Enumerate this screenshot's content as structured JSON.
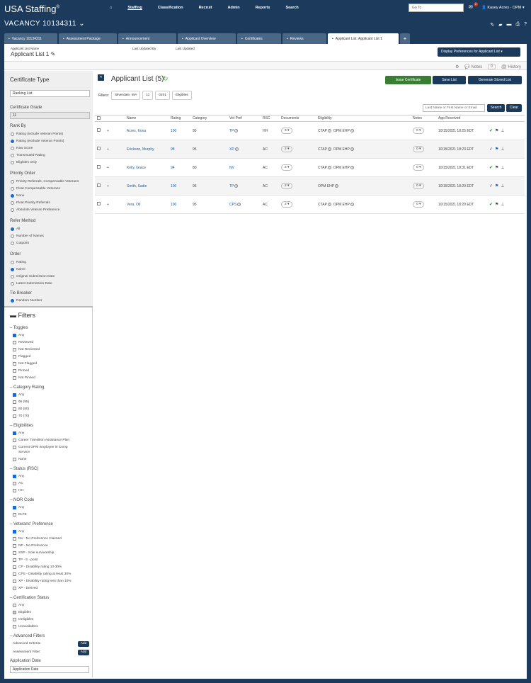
{
  "app": {
    "logo": "USA Staffing",
    "logo_mark": "®",
    "nav": [
      "Staffing",
      "Classification",
      "Recruit",
      "Admin",
      "Reports",
      "Search"
    ],
    "goto_placeholder": "Go To",
    "mail_count": "2",
    "user": "Kasey Acres - OPM"
  },
  "vacancy": {
    "title": "VACANCY 10134311"
  },
  "tabs": [
    "Vacancy 10134311",
    "Assessment Package",
    "Announcement",
    "Applicant Overview",
    "Certificates",
    "Reviews",
    "Applicant List: Applicant List 1"
  ],
  "header": {
    "list_name_label": "Applicant List Name",
    "list_name": "Applicant List 1",
    "updated_by_label": "Last Updated By",
    "updated_label": "Last Updated",
    "display_prefs": "Display Preferences for Applicant List"
  },
  "strip": {
    "notes": "Notes",
    "notes_count": "0",
    "history": "History"
  },
  "left": {
    "cert_type_title": "Certificate Type",
    "cert_type_value": "Ranking List",
    "cert_grade_label": "Certificate Grade",
    "cert_grade_value": "11",
    "rank_by_label": "Rank By",
    "rank_by": [
      "Rating (include Veteran Points)",
      "Rating (exclude Veteran Points)",
      "Raw Score",
      "Transmuted Rating",
      "Eligibles Only"
    ],
    "priority_label": "Priority Order",
    "priority": [
      "Priority Referrals, Compensable Veterans",
      "Float Compensable Veterans",
      "None",
      "Float Priority Referrals",
      "Absolute Veteran Preference"
    ],
    "refer_label": "Refer Method",
    "refer": [
      "All",
      "Number of Names",
      "Cutpoint"
    ],
    "order_label": "Order",
    "order": [
      "Rating",
      "Name",
      "Original Submission Date",
      "Latest Submission Date"
    ],
    "tie_label": "Tie Breaker",
    "tie": [
      "Random Number"
    ],
    "filters_title": "Filters",
    "toggles_label": "Toggles",
    "toggles": [
      "Any",
      "Reviewed",
      "Not Reviewed",
      "Flagged",
      "Not Flagged",
      "Pinned",
      "Not Pinned"
    ],
    "catrating_label": "Category Rating",
    "catrating": [
      "Any",
      "95 (95)",
      "80 (80)",
      "70 (70)"
    ],
    "elig_label": "Eligibilities",
    "elig": [
      "Any",
      "Career Transition Assistance Plan",
      "Current OPM employee in Comp",
      "Service",
      "None"
    ],
    "status_label": "Status (RSC)",
    "status": [
      "Any",
      "AC",
      "HH"
    ],
    "nor_label": "NOR Code",
    "nor": [
      "Any",
      "ELTE"
    ],
    "vet_label": "Veterans' Preference",
    "vet": [
      "Any",
      "NV - No Preference Claimed",
      "NP - No Preference",
      "SSP - Sole survivorship",
      "TP - 5 - point",
      "CP - Disability rating 10-30%",
      "CPS - Disability rating at least 30%",
      "XP - Disability rating less than 10%",
      "XP - Derived"
    ],
    "certstat_label": "Certification Status",
    "certstat": [
      "Any",
      "Eligibles",
      "Ineligibles",
      "Unavailables"
    ],
    "adv_label": "Advanced Filters",
    "adv_criteria": "Advanced Criteria:",
    "assess_filter": "Assessment Filter:",
    "add": "Add",
    "appdate_label": "Application Date",
    "appdate_value": "Application Date"
  },
  "list": {
    "title": "Applicant List (5)",
    "issue": "Issue Certificate",
    "save": "Save List",
    "generate": "Generate Stored List",
    "filters_label": "Filters:",
    "filters": [
      "Silverdale, WA",
      "11",
      "0201",
      "Eligibles"
    ],
    "search_placeholder": "Last Name or First Name or Email",
    "search_btn": "Search",
    "clear_btn": "Clear",
    "columns": [
      "Name",
      "Rating",
      "Category",
      "Vet Pref",
      "RSC",
      "Documents",
      "Eligibility",
      "Notes",
      "App Received"
    ],
    "rows": [
      {
        "name": "Acres, Kona",
        "rating": "100",
        "category": "95",
        "vet": "TP",
        "rsc": "HH",
        "docs": "3",
        "elig1": "CTAP",
        "elig2": "OPM EHP",
        "notes": "0",
        "received": "10/15/2021 18:25 EDT"
      },
      {
        "name": "Erickson, Murphy",
        "rating": "98",
        "category": "95",
        "vet": "XP",
        "rsc": "AC",
        "docs": "2",
        "elig1": "CTAP",
        "elig2": "OPM EHP",
        "notes": "0",
        "received": "10/15/2021 18:23 EDT"
      },
      {
        "name": "Kelly, Grace",
        "rating": "94",
        "category": "80",
        "vet": "NV",
        "rsc": "AC",
        "docs": "2",
        "elig1": "CTAP",
        "elig2": "OPM EHP",
        "notes": "0",
        "received": "10/15/2021 18:31 EDT"
      },
      {
        "name": "Smith, Sadie",
        "rating": "100",
        "category": "95",
        "vet": "TP",
        "rsc": "AC",
        "docs": "2",
        "elig1": "OPM EHP",
        "elig2": "",
        "notes": "0",
        "received": "10/15/2021 18:20 EDT"
      },
      {
        "name": "Vera, Oli",
        "rating": "100",
        "category": "95",
        "vet": "CPS",
        "rsc": "AC",
        "docs": "2",
        "elig1": "CTAP",
        "elig2": "OPM EHP",
        "notes": "0",
        "received": "10/15/2021 18:20 EDT"
      }
    ]
  }
}
